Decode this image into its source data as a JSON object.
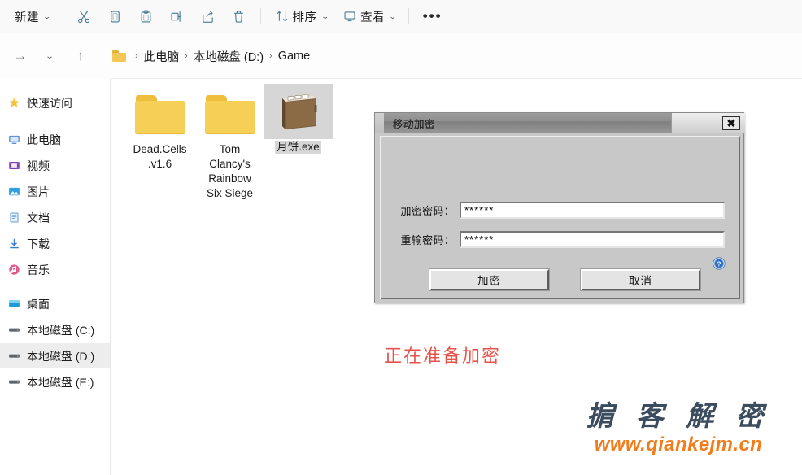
{
  "toolbar": {
    "new_label": "新建",
    "sort_label": "排序",
    "view_label": "查看",
    "more_label": "•••",
    "chevron": "⌄",
    "items": [
      {
        "name": "cut-icon",
        "tooltip": "剪切"
      },
      {
        "name": "copy-icon",
        "tooltip": "复制"
      },
      {
        "name": "paste-icon",
        "tooltip": "粘贴"
      },
      {
        "name": "rename-icon",
        "tooltip": "重命名"
      },
      {
        "name": "share-icon",
        "tooltip": "共享"
      },
      {
        "name": "delete-icon",
        "tooltip": "删除"
      }
    ]
  },
  "address": {
    "forward_glyph": "→",
    "recent_glyph": "⌄",
    "up_glyph": "↑",
    "separator": "›",
    "crumbs": [
      "此电脑",
      "本地磁盘 (D:)",
      "Game"
    ]
  },
  "sidebar": {
    "items": [
      {
        "label": "快速访问",
        "icon": "star-icon",
        "selected": false
      },
      {
        "label": "此电脑",
        "icon": "pc-icon",
        "selected": false
      },
      {
        "label": "视频",
        "icon": "video-icon",
        "selected": false
      },
      {
        "label": "图片",
        "icon": "pictures-icon",
        "selected": false
      },
      {
        "label": "文档",
        "icon": "documents-icon",
        "selected": false
      },
      {
        "label": "下载",
        "icon": "downloads-icon",
        "selected": false
      },
      {
        "label": "音乐",
        "icon": "music-icon",
        "selected": false
      },
      {
        "label": "桌面",
        "icon": "desktop-icon",
        "selected": false
      },
      {
        "label": "本地磁盘 (C:)",
        "icon": "drive-icon",
        "selected": false
      },
      {
        "label": "本地磁盘 (D:)",
        "icon": "drive-icon",
        "selected": true
      },
      {
        "label": "本地磁盘 (E:)",
        "icon": "drive-icon",
        "selected": false
      }
    ]
  },
  "files": [
    {
      "name": "Dead.Cells\n.v1.6",
      "line1": "Dead.Cells",
      "line2": ".v1.6",
      "line3": "",
      "line4": "",
      "type": "folder",
      "selected": false
    },
    {
      "name": "Tom Clancy's Rainbow Six Siege",
      "line1": "Tom",
      "line2": "Clancy's",
      "line3": "Rainbow",
      "line4": "Six Siege",
      "type": "folder",
      "selected": false
    },
    {
      "name": "月饼.exe",
      "line1": "月饼.exe",
      "line2": "",
      "line3": "",
      "line4": "",
      "type": "exe",
      "selected": true
    }
  ],
  "dialog": {
    "title": "移动加密",
    "close_glyph": "✖",
    "fields": [
      {
        "label": "加密密码：",
        "value": "******"
      },
      {
        "label": "重输密码：",
        "value": "******"
      }
    ],
    "help_glyph": "?",
    "buttons": [
      {
        "label": "加密",
        "primary": true
      },
      {
        "label": "取消",
        "primary": false
      }
    ]
  },
  "status": {
    "text": "正在准备加密",
    "color": "#e5534b"
  },
  "watermark": {
    "cn_text": "掮 客 解 密",
    "url_text": "www.qiankejm.cn",
    "cn_color": "#3b4c5e",
    "url_color": "#f07c1b"
  }
}
